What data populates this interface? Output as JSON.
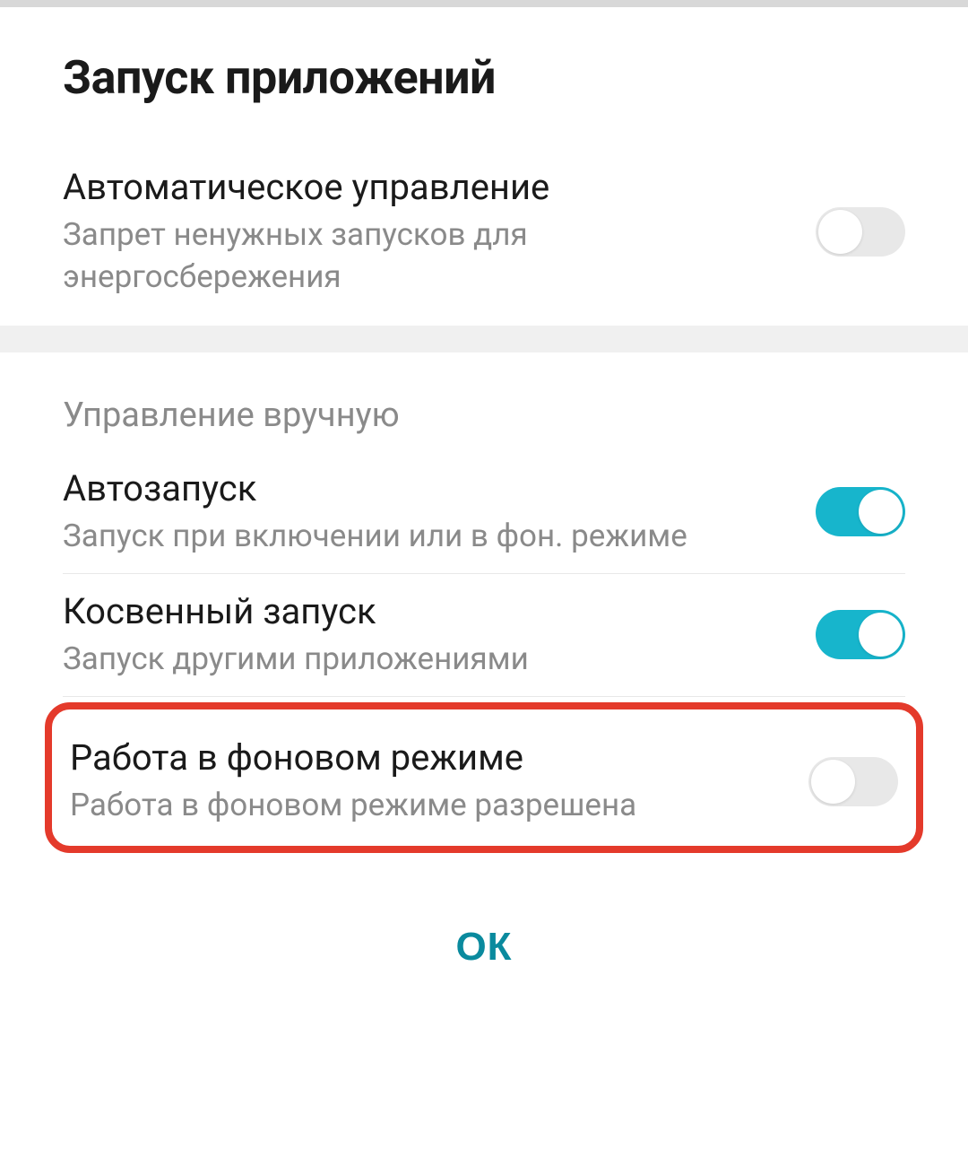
{
  "dialog": {
    "title": "Запуск приложений",
    "ok_label": "ОК"
  },
  "auto_manage": {
    "title": "Автоматическое управление",
    "desc": "Запрет ненужных запусков для энергосбережения"
  },
  "manual_section": {
    "header": "Управление вручную"
  },
  "autostart": {
    "title": "Автозапуск",
    "desc": "Запуск при включении или в фон. режиме"
  },
  "indirect": {
    "title": "Косвенный запуск",
    "desc": "Запуск другими приложениями"
  },
  "background": {
    "title": "Работа в фоновом режиме",
    "desc": "Работа в фоновом режиме разрешена"
  }
}
